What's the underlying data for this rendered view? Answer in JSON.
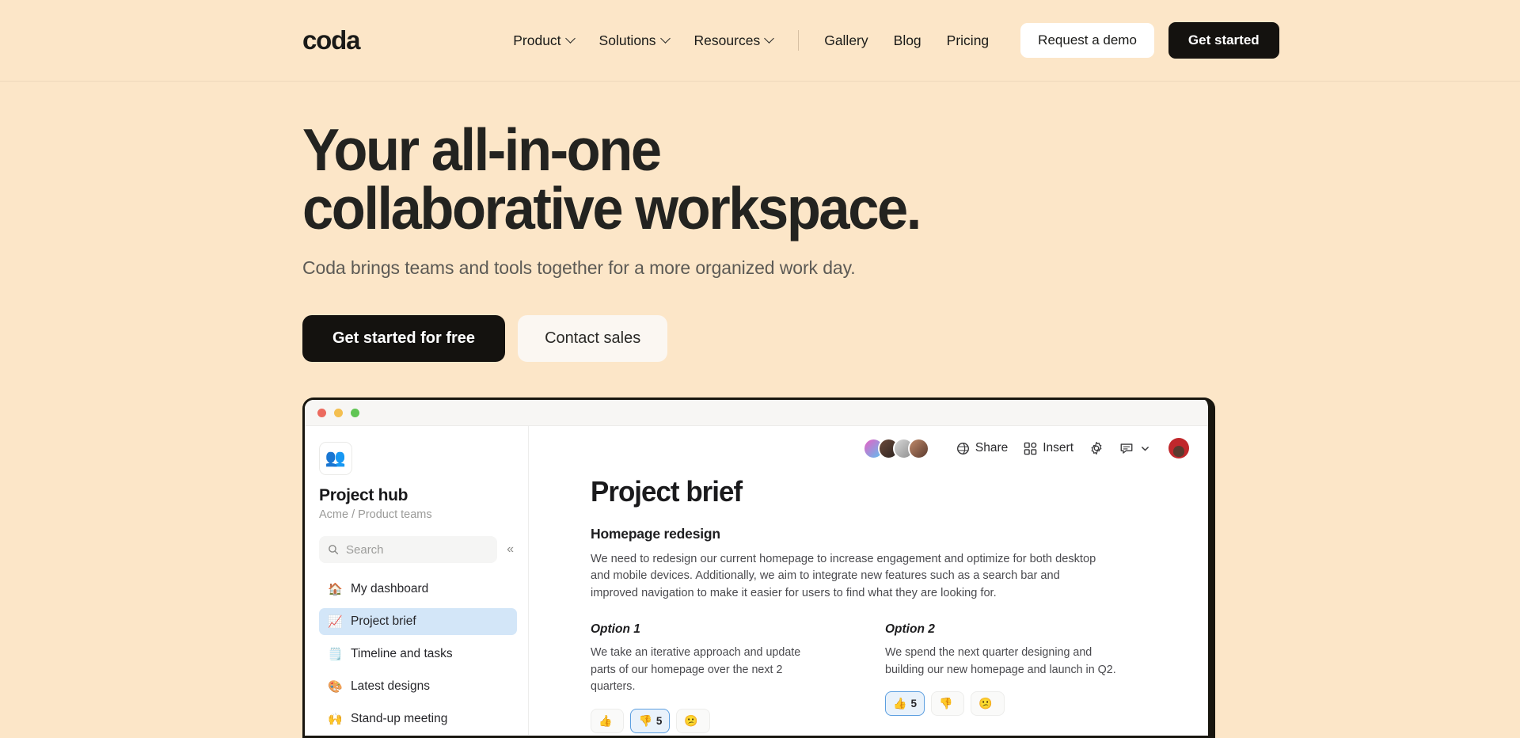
{
  "colors": {
    "page_bg": "#FCE6C8",
    "ink": "#1A1A18",
    "accent_dark": "#14120F",
    "nav_active": "#D3E6F8",
    "chip_selected_border": "#5C9FE0"
  },
  "nav": {
    "logo": "coda",
    "menu": [
      {
        "label": "Product",
        "has_caret": true
      },
      {
        "label": "Solutions",
        "has_caret": true
      },
      {
        "label": "Resources",
        "has_caret": true
      }
    ],
    "links": [
      {
        "label": "Gallery"
      },
      {
        "label": "Blog"
      },
      {
        "label": "Pricing"
      }
    ],
    "demo_button": "Request a demo",
    "start_button": "Get started"
  },
  "hero": {
    "headline_line1": "Your all-in-one",
    "headline_line2": "collaborative workspace.",
    "subhead": "Coda brings teams and tools together for a more organized work day.",
    "cta_primary": "Get started for free",
    "cta_secondary": "Contact sales"
  },
  "mockup": {
    "window_dots": [
      "#EC6A5E",
      "#F4BF4F",
      "#61C554"
    ],
    "sidebar": {
      "doc_emoji": "👥",
      "doc_title": "Project hub",
      "breadcrumb": "Acme / Product teams",
      "search_placeholder": "Search",
      "collapse_icon": "«",
      "items": [
        {
          "emoji": "🏠",
          "label": "My dashboard",
          "active": false
        },
        {
          "emoji": "📈",
          "label": "Project brief",
          "active": true
        },
        {
          "emoji": "🗒️",
          "label": "Timeline and tasks",
          "active": false
        },
        {
          "emoji": "🎨",
          "label": "Latest designs",
          "active": false
        },
        {
          "emoji": "🙌",
          "label": "Stand-up meeting",
          "active": false
        }
      ]
    },
    "toolbar": {
      "share_label": "Share",
      "insert_label": "Insert",
      "settings_icon": "gear-icon",
      "comment_icon": "comment-icon",
      "collaborator_count": 4
    },
    "document": {
      "title": "Project brief",
      "section_heading": "Homepage redesign",
      "paragraph": "We need to redesign our current homepage to increase engagement and optimize for both desktop and mobile devices. Additionally, we aim to integrate new features such as a search bar and improved navigation to make it easier for users to find what they are looking for.",
      "options": [
        {
          "title": "Option 1",
          "body": "We take an iterative approach and update parts of our homepage over the next 2 quarters.",
          "reactions": [
            {
              "emoji": "👍",
              "count": "",
              "selected": false
            },
            {
              "emoji": "👎",
              "count": "5",
              "selected": true
            },
            {
              "emoji": "😕",
              "count": "",
              "selected": false
            }
          ]
        },
        {
          "title": "Option 2",
          "body": "We spend the next quarter designing and building our new homepage and launch in Q2.",
          "reactions": [
            {
              "emoji": "👍",
              "count": "5",
              "selected": true
            },
            {
              "emoji": "👎",
              "count": "",
              "selected": false
            },
            {
              "emoji": "😕",
              "count": "",
              "selected": false
            }
          ]
        }
      ]
    }
  }
}
